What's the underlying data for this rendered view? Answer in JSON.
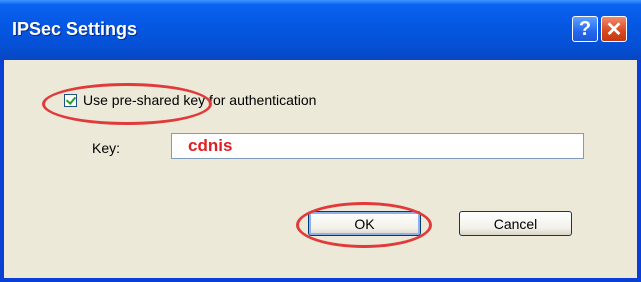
{
  "window": {
    "title": "IPSec Settings",
    "help_glyph": "?",
    "close_glyph": "✕"
  },
  "dialog": {
    "preshared_checkbox": {
      "label": "Use pre-shared key for authentication",
      "checked": true
    },
    "key_label": "Key:",
    "key_value": "cdnis",
    "ok_label": "OK",
    "cancel_label": "Cancel"
  },
  "colors": {
    "titlebar": "#0558e3",
    "client_bg": "#ece9d8",
    "key_text": "#e02020",
    "annotation": "#e03a3a"
  }
}
